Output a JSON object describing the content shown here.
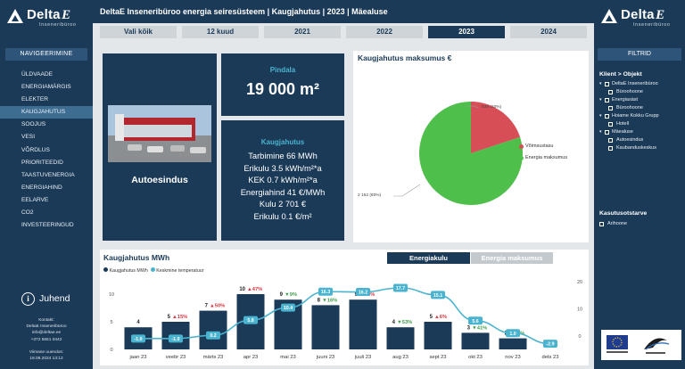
{
  "brand": {
    "name_prefix": "Delta",
    "name_suffix": "E",
    "tagline": "Inseneribüroo"
  },
  "left_nav": {
    "header": "NAVIGEERIMINE",
    "items": [
      "ÜLDVAADE",
      "ENERGIAMÄRGIS",
      "ELEKTER",
      "KAUGJAHUTUS",
      "SOOJUS",
      "VESI",
      "VÕRDLUS",
      "PRIORITEEDID",
      "TAASTUVENERGIA",
      "ENERGIAHIND",
      "EELARVE",
      "CO2",
      "INVESTEERINGUD"
    ],
    "active_item": "KAUGJAHUTUS",
    "help_label": "Juhend",
    "contact": [
      "Kontakt:",
      "DeltaE Inseneribüroo",
      "info@deltae.ee",
      "+372 5551 0442"
    ],
    "updated": [
      "Viimane uuendus:",
      "19.08.2024 13:12"
    ]
  },
  "header": {
    "title": "DeltaE Inseneribüroo energia seiresüsteem | Kaugjahutus | 2023 | Mäealuse"
  },
  "year_tabs": {
    "items": [
      "Vali kõik",
      "12 kuud",
      "2021",
      "2022",
      "2023",
      "2024"
    ],
    "selected": "2023"
  },
  "building": {
    "name": "Autoesindus"
  },
  "area": {
    "label": "Pindala",
    "value": "19 000 m²"
  },
  "cooling_summary": {
    "label": "Kaugjahutus",
    "lines": [
      "Tarbimine 66 MWh",
      "Erikulu 3.5 kWh/m²*a",
      "KEK 0.7 kWh/m²*a",
      "Energiahind 41 €/MWh",
      "Kulu 2 701 €",
      "Erikulu 0.1 €/m²"
    ]
  },
  "cost_chart": {
    "title": "Kaugjahutus maksumus €",
    "slice_labels": [
      "539 (20%)",
      "2 162 (80%)"
    ],
    "legend": [
      "Võimsustasu",
      "Energia maksumus"
    ],
    "colors": {
      "capacity": "#d84e57",
      "energy": "#4fbf4b"
    }
  },
  "monthly_chart": {
    "title": "Kaugjahutus MWh",
    "legend": [
      "Kaugjahutus MWh",
      "Keskmine temperatuur"
    ],
    "toggle": [
      "Energiakulu",
      "Energia maksumus"
    ],
    "toggle_selected": "Energiakulu",
    "colors": {
      "bar": "#1b3a57",
      "line": "#4ab3cf",
      "up": "#d9343f",
      "down": "#3f9e4a"
    }
  },
  "filters": {
    "header": "FILTRID",
    "tree_title": "Klient > Objekt",
    "tree": [
      {
        "label": "DeltaE Inseneribüroo",
        "children": [
          "Büroohoone"
        ]
      },
      {
        "label": "Energiasäst",
        "children": [
          "Büroohoone"
        ]
      },
      {
        "label": "Hoiame Kokku Grupp",
        "children": [
          "Hotell"
        ]
      },
      {
        "label": "Mäealuse",
        "children": [
          "Autoesindus",
          "Kaubanduskeskus"
        ]
      }
    ],
    "usage_title": "Kasutusotstarve",
    "usage": [
      "Arihoone"
    ]
  },
  "chart_data": [
    {
      "type": "pie",
      "title": "Kaugjahutus maksumus €",
      "categories": [
        "Võimsustasu",
        "Energia maksumus"
      ],
      "values": [
        539,
        2162
      ],
      "percent": [
        20,
        80
      ]
    },
    {
      "type": "bar",
      "title": "Kaugjahutus MWh",
      "categories": [
        "jaan 23",
        "veebr 23",
        "märts 23",
        "apr 23",
        "mai 23",
        "juuni 23",
        "juuli 23",
        "aug 23",
        "sept 23",
        "okt 23",
        "nov 23",
        "dets 23"
      ],
      "series": [
        {
          "name": "Kaugjahutus MWh",
          "type": "bar",
          "axis": "left",
          "values": [
            4,
            5,
            7,
            10,
            9,
            8,
            9,
            4,
            5,
            3,
            2,
            0
          ]
        },
        {
          "name": "Keskmine temperatuur",
          "type": "line",
          "axis": "right",
          "values": [
            -1.0,
            -1.0,
            0.2,
            5.8,
            10.4,
            16.3,
            16.2,
            17.7,
            15.1,
            5.6,
            1.0,
            -2.9
          ]
        }
      ],
      "change_labels": [
        "",
        "15%",
        "50%",
        "47%",
        "9%",
        "16%",
        "15%",
        "53%",
        "6%",
        "41%",
        "17%",
        ""
      ],
      "change_direction": [
        "",
        "up",
        "up",
        "up",
        "down",
        "down",
        "up",
        "down",
        "up",
        "down",
        "down",
        ""
      ],
      "ylim_left": [
        0,
        10
      ],
      "yticks_left": [
        0,
        5,
        10
      ],
      "ylim_right": [
        -5,
        20
      ],
      "yticks_right": [
        0,
        10,
        20
      ]
    }
  ]
}
